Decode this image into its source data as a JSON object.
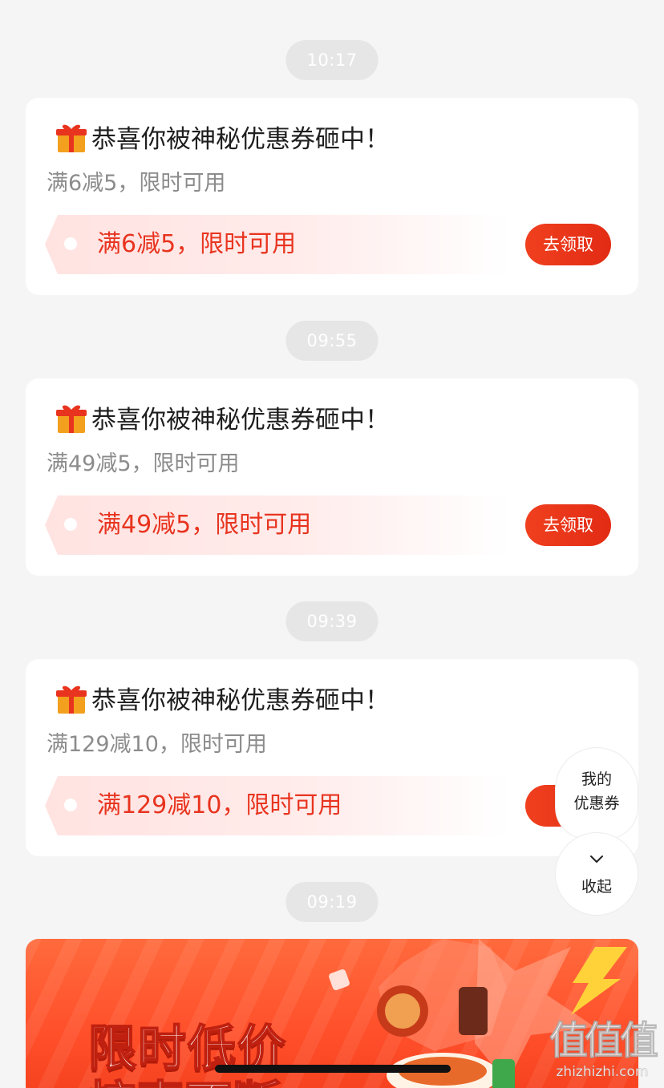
{
  "messages": [
    {
      "time": "10:17",
      "title": "恭喜你被神秘优惠券砸中！",
      "subtitle": "满6减5，限时可用",
      "coupon_text": "满6减5，限时可用",
      "button_label": "去领取"
    },
    {
      "time": "09:55",
      "title": "恭喜你被神秘优惠券砸中！",
      "subtitle": "满49减5，限时可用",
      "coupon_text": "满49减5，限时可用",
      "button_label": "去领取"
    },
    {
      "time": "09:39",
      "title": "恭喜你被神秘优惠券砸中！",
      "subtitle": "满129减10，限时可用",
      "coupon_text": "满129减10，限时可用",
      "button_label": "去"
    },
    {
      "time": "09:19"
    }
  ],
  "float_widget": {
    "my_label_line1": "我的",
    "my_label_line2": "优惠券",
    "collapse_label": "收起"
  },
  "banner": {
    "title_line1": "限时低价",
    "title_line2": "惊喜不断"
  },
  "watermark": {
    "glyphs": "值值值",
    "url": "zhizhizhi.com"
  },
  "colors": {
    "accent": "#e8341f",
    "background": "#f5f5f5"
  }
}
